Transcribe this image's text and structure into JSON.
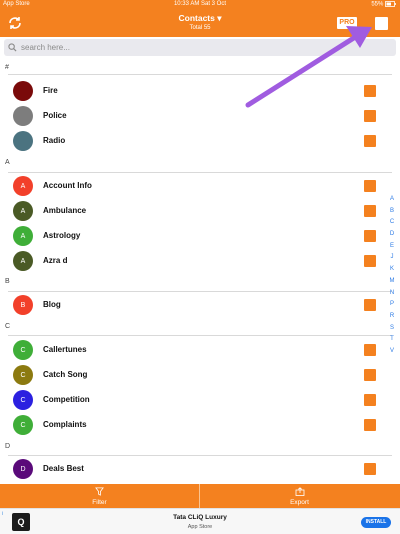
{
  "status_bar": {
    "left": "App Store",
    "time": "10:33 AM",
    "date": "Sat 3 Oct",
    "battery": "55%"
  },
  "nav": {
    "title": "Contacts ▾",
    "subtitle": "Total 55",
    "pro_label": "PRO",
    "accent_color": "#f4811f"
  },
  "search": {
    "placeholder": "search here..."
  },
  "sections": {
    "hash": "#",
    "a": "A",
    "b": "B",
    "c": "C",
    "d": "D"
  },
  "contacts": [
    {
      "name": "Fire",
      "initial": "",
      "color": "#7a0a0a"
    },
    {
      "name": "Police",
      "initial": "",
      "color": "#7d7d7d"
    },
    {
      "name": "Radio",
      "initial": "",
      "color": "#4b7380"
    },
    {
      "name": "Account Info",
      "initial": "A",
      "color": "#f2402a"
    },
    {
      "name": "Ambulance",
      "initial": "A",
      "color": "#4a5a25"
    },
    {
      "name": "Astrology",
      "initial": "A",
      "color": "#3fae38"
    },
    {
      "name": "Azra d",
      "initial": "A",
      "color": "#4a5a25"
    },
    {
      "name": "Blog",
      "initial": "B",
      "color": "#f2402a"
    },
    {
      "name": "Callertunes",
      "initial": "C",
      "color": "#3fae38"
    },
    {
      "name": "Catch Song",
      "initial": "C",
      "color": "#8c7a10"
    },
    {
      "name": "Competition",
      "initial": "C",
      "color": "#2b20e0"
    },
    {
      "name": "Complaints",
      "initial": "C",
      "color": "#3fae38"
    },
    {
      "name": "Deals Best",
      "initial": "D",
      "color": "#5a0a7a"
    }
  ],
  "alpha_index": [
    "A",
    "B",
    "C",
    "D",
    "E",
    "J",
    "K",
    "M",
    "N",
    "P",
    "R",
    "S",
    "T",
    "V"
  ],
  "bottom": {
    "filter_label": "Filter",
    "export_label": "Export"
  },
  "ad": {
    "title": "Tata CLiQ Luxury",
    "subtitle": "App Store",
    "install_label": "INSTALL",
    "logo_text": "Q",
    "info_label": "i"
  }
}
